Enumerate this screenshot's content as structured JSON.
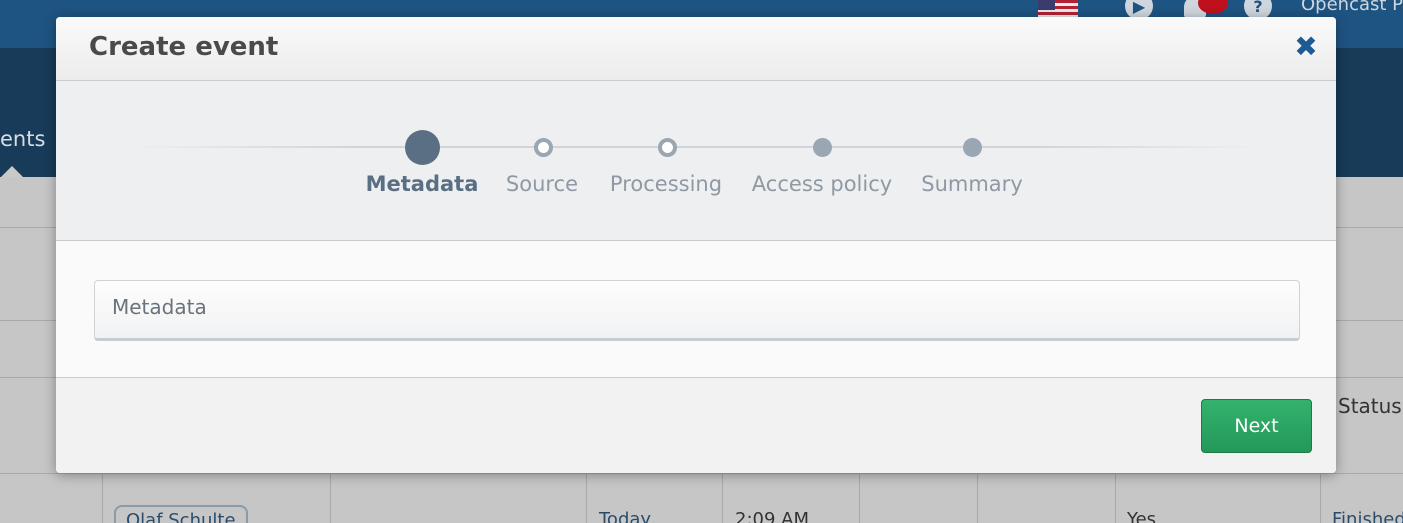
{
  "header": {
    "org_name": "Opencast P",
    "icons": [
      "flag-us-icon",
      "play-icon",
      "bell-icon",
      "help-icon"
    ]
  },
  "nav": {
    "active_tab": "ents"
  },
  "table": {
    "status_header": "Status",
    "row": {
      "presenter": "Olaf Schulte",
      "date": "Today",
      "time": "2:09 AM",
      "published": "Yes",
      "status": "Finished"
    }
  },
  "modal": {
    "title": "Create event",
    "close_icon": "close-icon",
    "steps": [
      {
        "label": "Metadata",
        "state": "active"
      },
      {
        "label": "Source",
        "state": "pending"
      },
      {
        "label": "Processing",
        "state": "pending"
      },
      {
        "label": "Access policy",
        "state": "disabled"
      },
      {
        "label": "Summary",
        "state": "disabled"
      }
    ],
    "section_title": "Metadata",
    "next_label": "Next"
  },
  "colors": {
    "header_bg": "#1e5482",
    "active_step": "#5a6f84",
    "inactive_step": "#9aa6b2",
    "close_icon": "#1e5a94",
    "next_button": "#2aa862"
  }
}
